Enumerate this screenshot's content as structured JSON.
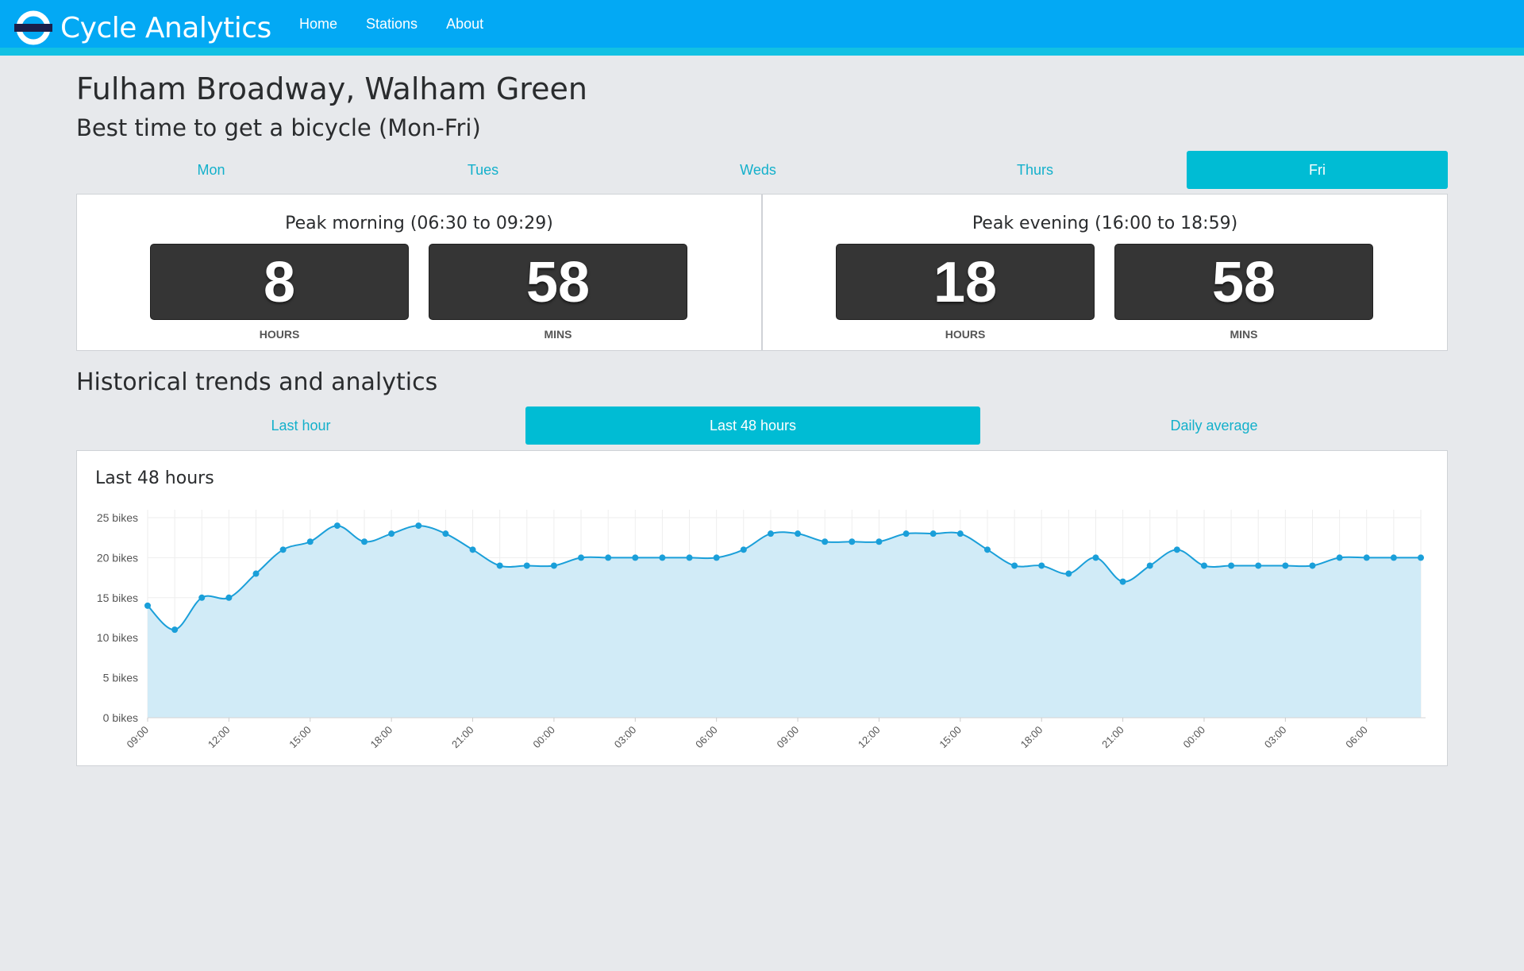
{
  "app": {
    "title": "Cycle Analytics"
  },
  "nav": {
    "items": [
      "Home",
      "Stations",
      "About"
    ]
  },
  "page": {
    "title": "Fulham Broadway, Walham Green",
    "subtitle": "Best time to get a bicycle (Mon-Fri)"
  },
  "day_tabs": [
    "Mon",
    "Tues",
    "Weds",
    "Thurs",
    "Fri"
  ],
  "active_day": "Fri",
  "peak": {
    "morning": {
      "title": "Peak morning (06:30 to 09:29)",
      "hours": "8",
      "mins": "58",
      "hours_label": "HOURS",
      "mins_label": "MINS"
    },
    "evening": {
      "title": "Peak evening (16:00 to 18:59)",
      "hours": "18",
      "mins": "58",
      "hours_label": "HOURS",
      "mins_label": "MINS"
    }
  },
  "history": {
    "title": "Historical trends and analytics",
    "tabs": [
      "Last hour",
      "Last 48 hours",
      "Daily average"
    ],
    "active_tab": "Last 48 hours",
    "chart_title": "Last 48 hours"
  },
  "colors": {
    "navbar": "#03a9f4",
    "accent": "#00bcd4",
    "line": "#1a9fd9",
    "area": "#cfeaf7"
  },
  "chart_data": {
    "type": "area",
    "title": "Last 48 hours",
    "ylim": [
      0,
      25
    ],
    "yticks": [
      "0 bikes",
      "5 bikes",
      "10 bikes",
      "15 bikes",
      "20 bikes",
      "25 bikes"
    ],
    "xticks": [
      "09:00",
      "12:00",
      "15:00",
      "18:00",
      "21:00",
      "00:00",
      "03:00",
      "06:00",
      "09:00",
      "12:00",
      "15:00",
      "18:00",
      "21:00",
      "00:00",
      "03:00",
      "06:00"
    ],
    "grid": true,
    "series": [
      {
        "values": [
          14,
          11,
          15,
          15,
          18,
          21,
          22,
          24,
          22,
          23,
          24,
          23,
          21,
          19,
          19,
          19,
          20,
          20,
          20,
          20,
          20,
          20,
          21,
          23,
          23,
          22,
          22,
          22,
          23,
          23,
          23,
          21,
          19,
          19,
          18,
          20,
          17,
          19,
          21,
          19,
          19,
          19,
          19,
          19,
          20,
          20,
          20,
          20
        ]
      }
    ]
  }
}
